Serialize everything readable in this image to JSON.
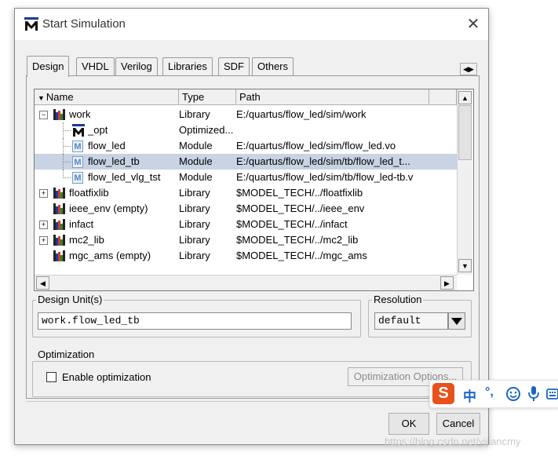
{
  "window": {
    "title": "Start Simulation",
    "app_icon": "modelsim-m-icon",
    "close_glyph": "✕"
  },
  "tabs": [
    {
      "label": "Design",
      "active": true
    },
    {
      "label": "VHDL",
      "active": false
    },
    {
      "label": "Verilog",
      "active": false
    },
    {
      "label": "Libraries",
      "active": false
    },
    {
      "label": "SDF",
      "active": false
    },
    {
      "label": "Others",
      "active": false
    }
  ],
  "table": {
    "columns": [
      "Name",
      "Type",
      "Path"
    ],
    "rows": [
      {
        "name": "work",
        "type": "Library",
        "path": "E:/quartus/flow_led/sim/work",
        "icon": "library-icon",
        "expander": "−",
        "selected": false
      },
      {
        "name": "_opt",
        "type": "Optimized...",
        "path": "",
        "icon": "optimized-icon",
        "expander": "",
        "selected": false
      },
      {
        "name": "flow_led",
        "type": "Module",
        "path": "E:/quartus/flow_led/sim/flow_led.vo",
        "icon": "module-icon",
        "expander": "",
        "selected": false
      },
      {
        "name": "flow_led_tb",
        "type": "Module",
        "path": "E:/quartus/flow_led/sim/tb/flow_led_t...",
        "icon": "module-icon",
        "expander": "",
        "selected": true
      },
      {
        "name": "flow_led_vlg_tst",
        "type": "Module",
        "path": "E:/quartus/flow_led/sim/tb/flow_led-tb.v",
        "icon": "module-icon",
        "expander": "",
        "selected": false
      },
      {
        "name": "floatfixlib",
        "type": "Library",
        "path": "$MODEL_TECH/../floatfixlib",
        "icon": "library-icon",
        "expander": "+",
        "selected": false
      },
      {
        "name": "ieee_env  (empty)",
        "type": "Library",
        "path": "$MODEL_TECH/../ieee_env",
        "icon": "library-icon",
        "expander": "",
        "selected": false
      },
      {
        "name": "infact",
        "type": "Library",
        "path": "$MODEL_TECH/../infact",
        "icon": "library-icon",
        "expander": "+",
        "selected": false
      },
      {
        "name": "mc2_lib",
        "type": "Library",
        "path": "$MODEL_TECH/../mc2_lib",
        "icon": "library-icon",
        "expander": "+",
        "selected": false
      },
      {
        "name": "mgc_ams  (empty)",
        "type": "Library",
        "path": "$MODEL_TECH/../mgc_ams",
        "icon": "library-icon",
        "expander": "",
        "selected": false
      }
    ]
  },
  "design_unit": {
    "label": "Design Unit(s)",
    "value": "work.flow_led_tb"
  },
  "resolution": {
    "label": "Resolution",
    "value": "default"
  },
  "optimization": {
    "label": "Optimization",
    "checkbox_label": "Enable optimization",
    "checked": false,
    "options_button": "Optimization Options..."
  },
  "buttons": {
    "ok": "OK",
    "cancel": "Cancel"
  },
  "ime_toolbar": {
    "logo": "S",
    "mode": "中",
    "punct": "°,",
    "items": [
      "sogou-logo-icon",
      "smiley-icon",
      "microphone-icon",
      "keyboard-icon"
    ]
  },
  "watermark": "https://blog.csdn.net/yijiancmy",
  "colors": {
    "selection": "#c8d3e3",
    "sogou": "#e8501c",
    "ime_blue": "#1b64c8"
  }
}
